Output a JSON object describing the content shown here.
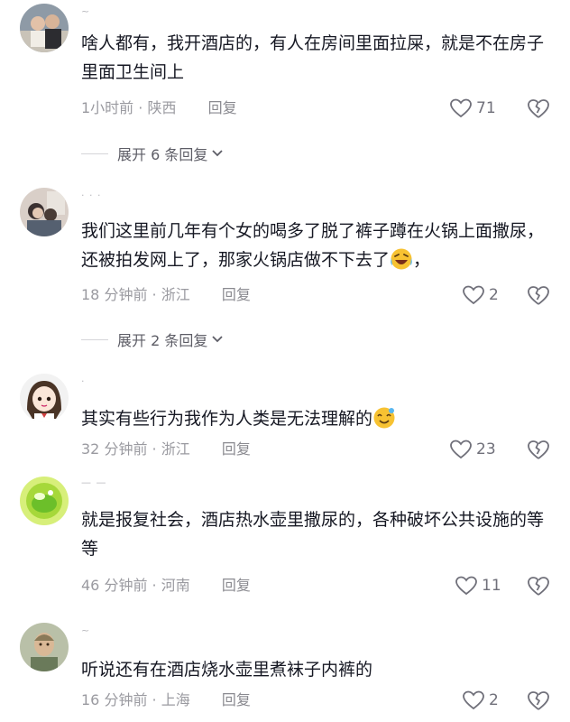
{
  "comments": [
    {
      "username": "~",
      "text": "啥人都有，我开酒店的，有人在房间里面拉屎，就是不在房子里面卫生间上",
      "time": "1小时前",
      "location": "陕西",
      "reply_label": "回复",
      "likes": "71",
      "expand_label": "展开 6 条回复"
    },
    {
      "username": "· · ·",
      "text": "我们这里前几年有个女的喝多了脱了裤子蹲在火锅上面撒尿，还被拍发网上了，那家火锅店做不下去了",
      "text_suffix": "，",
      "emoji": "laughing-tears-emoji",
      "time": "18 分钟前",
      "location": "浙江",
      "reply_label": "回复",
      "likes": "2",
      "expand_label": "展开 2 条回复"
    },
    {
      "username": "·",
      "text": "其实有些行为我作为人类是无法理解的",
      "emoji": "dizzy-smile-emoji",
      "time": "32 分钟前",
      "location": "浙江",
      "reply_label": "回复",
      "likes": "23"
    },
    {
      "username": "— —",
      "text": "就是报复社会，酒店热水壶里撒尿的，各种破坏公共设施的等等",
      "time": "46 分钟前",
      "location": "河南",
      "reply_label": "回复",
      "likes": "11"
    },
    {
      "username": "~",
      "text": "听说还有在酒店烧水壶里煮袜子内裤的",
      "time": "16 分钟前",
      "location": "上海",
      "reply_label": "回复",
      "likes": "2"
    }
  ],
  "separator": "·",
  "colors": {
    "text": "#161823",
    "meta": "#9a9aa0",
    "icon": "#70707a"
  }
}
